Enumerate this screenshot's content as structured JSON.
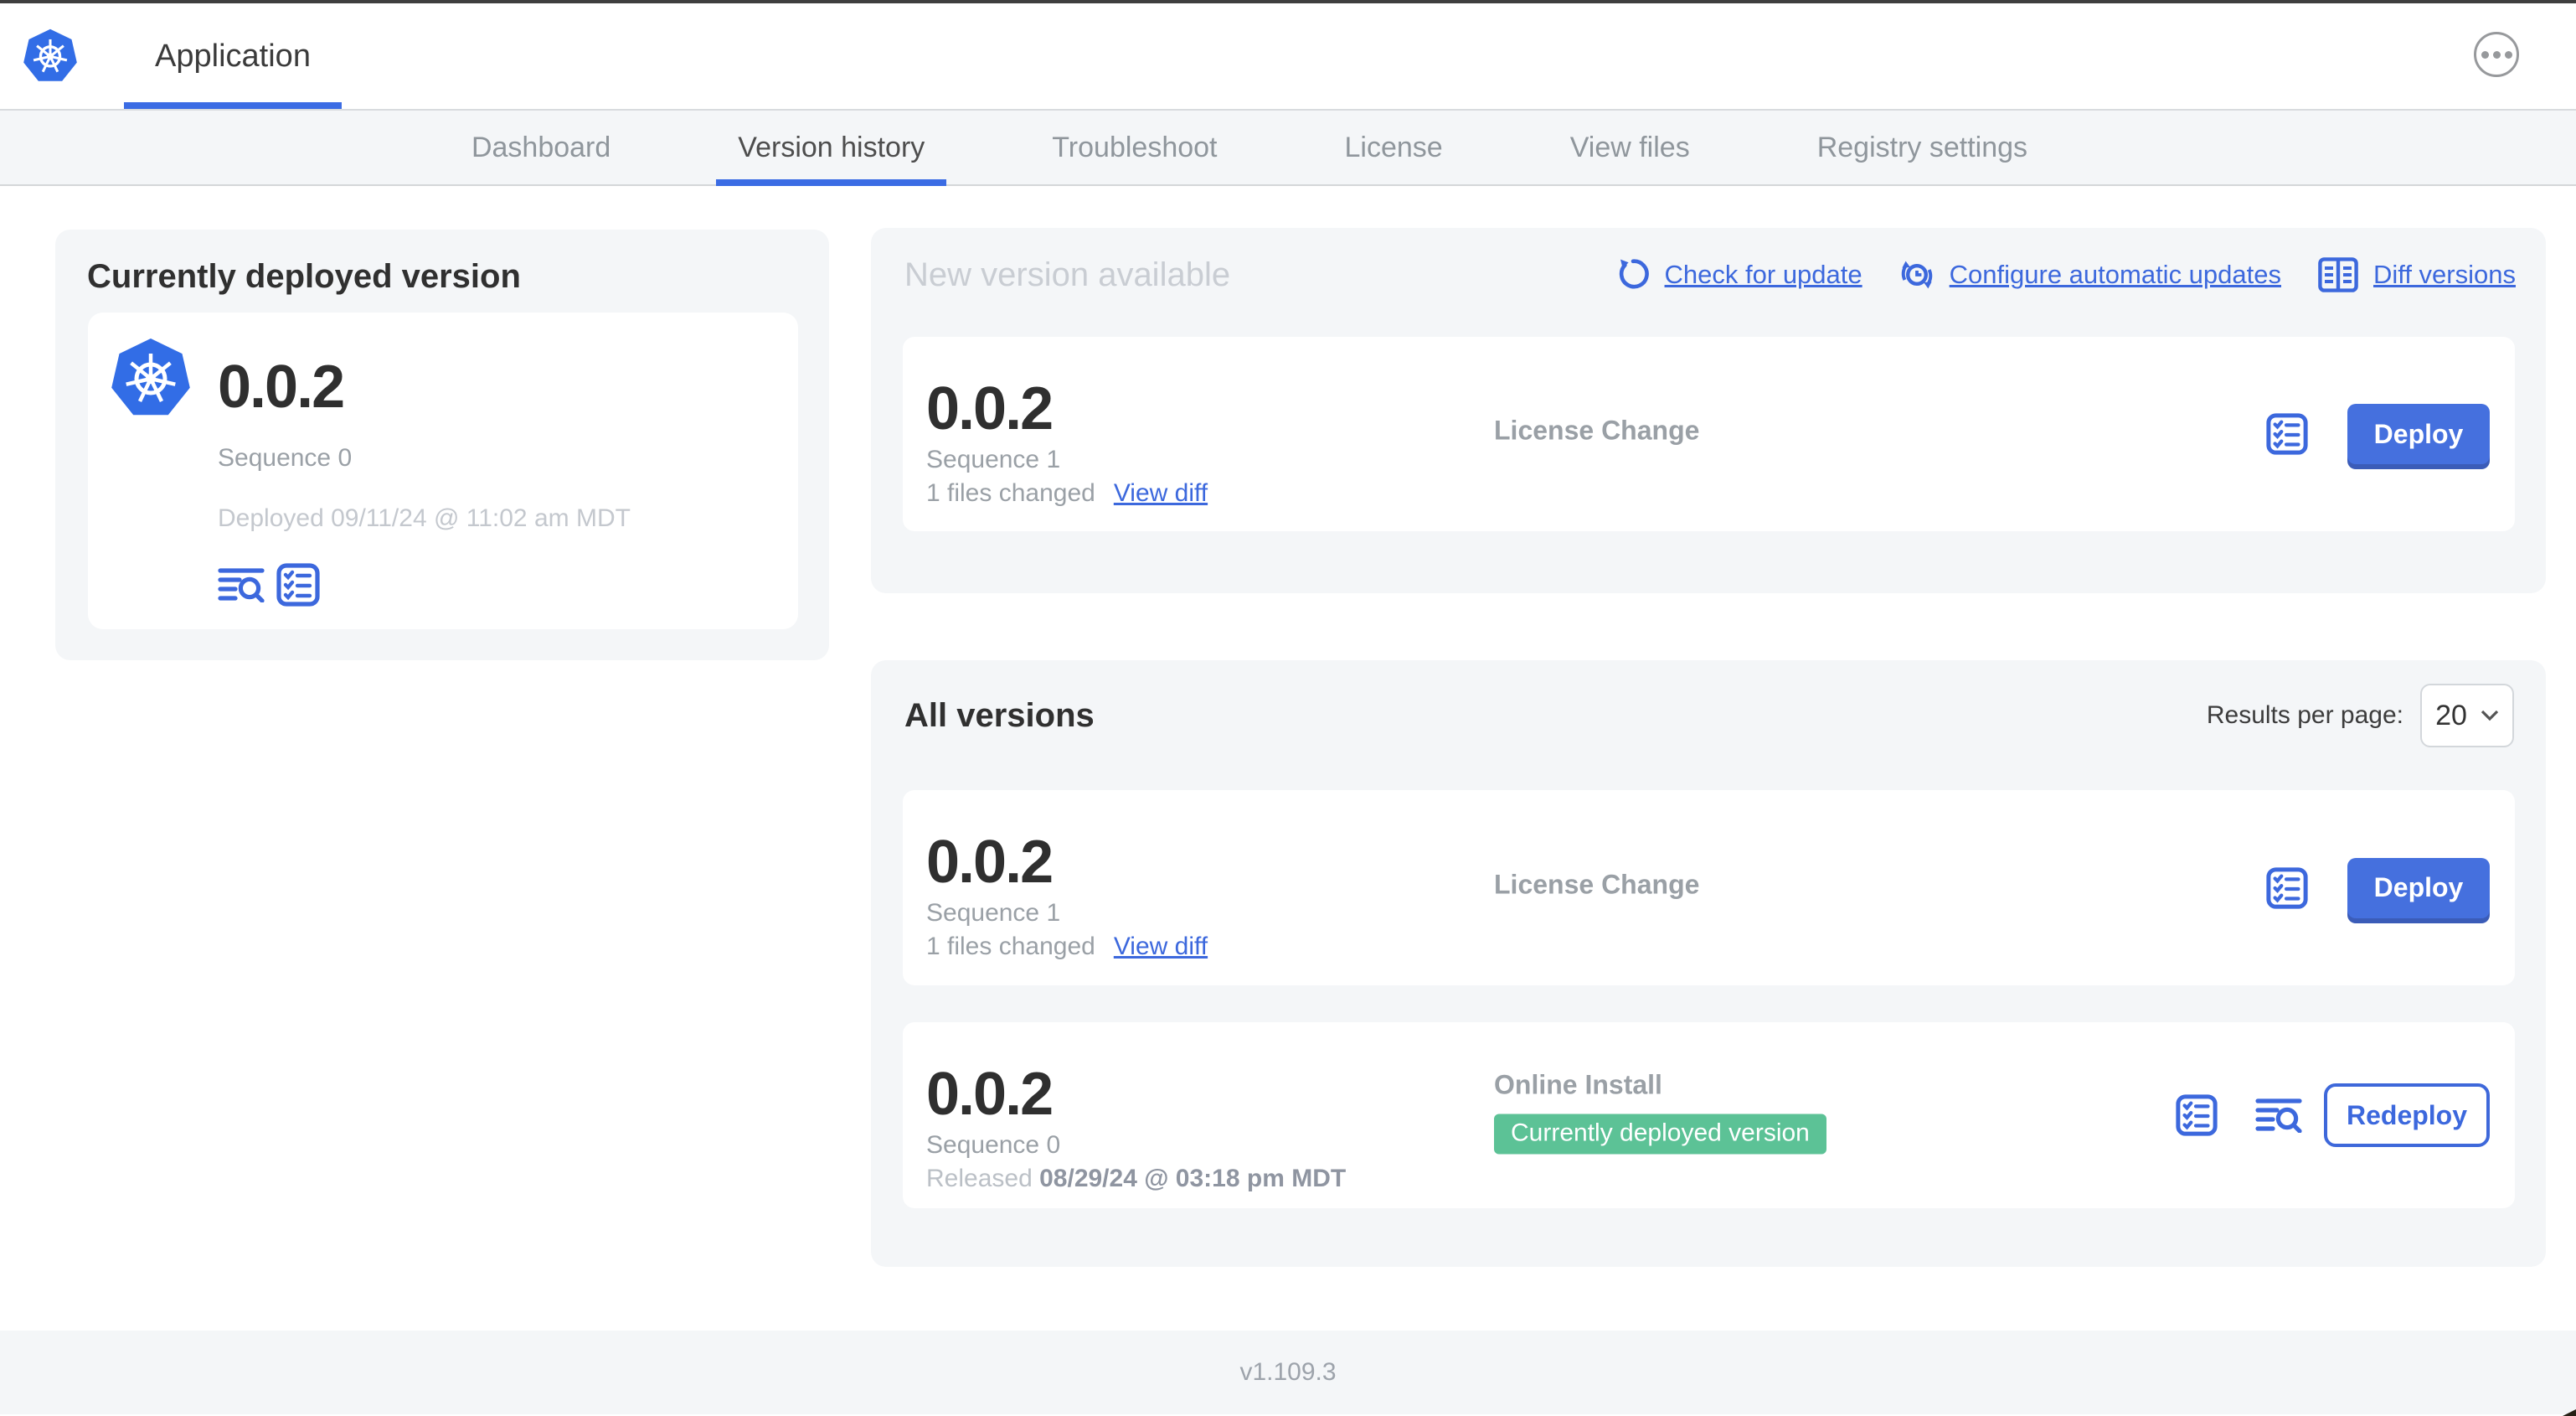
{
  "header": {
    "app_tab": "Application"
  },
  "nav": {
    "tabs": [
      "Dashboard",
      "Version history",
      "Troubleshoot",
      "License",
      "View files",
      "Registry settings"
    ],
    "active_tab": "Version history"
  },
  "current_deployed": {
    "title": "Currently deployed version",
    "version": "0.0.2",
    "sequence": "Sequence 0",
    "deployed_at": "Deployed 09/11/24 @ 11:02 am MDT"
  },
  "new_version": {
    "title": "New version available",
    "links": {
      "check": "Check for update",
      "configure": "Configure automatic updates",
      "diff": "Diff versions"
    },
    "row": {
      "version": "0.0.2",
      "sequence": "Sequence 1",
      "changes": "1 files changed",
      "view_diff": "View diff",
      "source": "License Change",
      "action": "Deploy"
    }
  },
  "all_versions": {
    "title": "All versions",
    "results_per_page_label": "Results per page:",
    "results_per_page": "20",
    "rows": [
      {
        "version": "0.0.2",
        "sequence": "Sequence 1",
        "changes": "1 files changed",
        "view_diff": "View diff",
        "source": "License Change",
        "action": "Deploy"
      },
      {
        "version": "0.0.2",
        "sequence": "Sequence 0",
        "released_prefix": "Released",
        "released_date": "08/29/24 @ 03:18 pm MDT",
        "source": "Online Install",
        "badge": "Currently deployed version",
        "action": "Redeploy"
      }
    ]
  },
  "footer": {
    "version": "v1.109.3"
  },
  "colors": {
    "accent_blue": "#3c68dd",
    "kubernetes_blue": "#326de6",
    "badge_green": "#5cc296",
    "card_gray": "#f4f6f8"
  }
}
